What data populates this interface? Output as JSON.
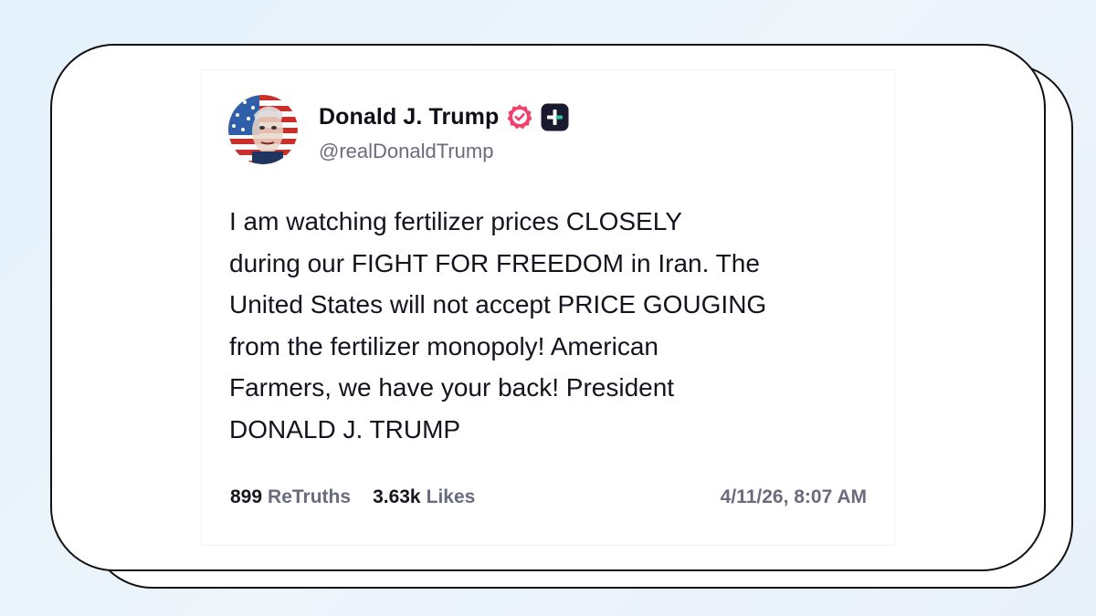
{
  "post": {
    "author": {
      "display_name": "Donald J. Trump",
      "handle": "@realDonaldTrump",
      "verified_icon": "verified-badge-icon",
      "extra_badge_icon": "plus-badge-icon",
      "accent_color": "#f23f6b"
    },
    "text": "I am watching fertilizer prices CLOSELY\nduring our FIGHT FOR FREEDOM in Iran. The\nUnited States will not accept PRICE GOUGING\nfrom the fertilizer monopoly! American\nFarmers, we have your back! President\nDONALD J. TRUMP",
    "stats": {
      "retruths_count": "899",
      "retruths_label": "ReTruths",
      "likes_count": "3.63k",
      "likes_label": "Likes"
    },
    "timestamp": "4/11/26, 8:07 AM"
  }
}
